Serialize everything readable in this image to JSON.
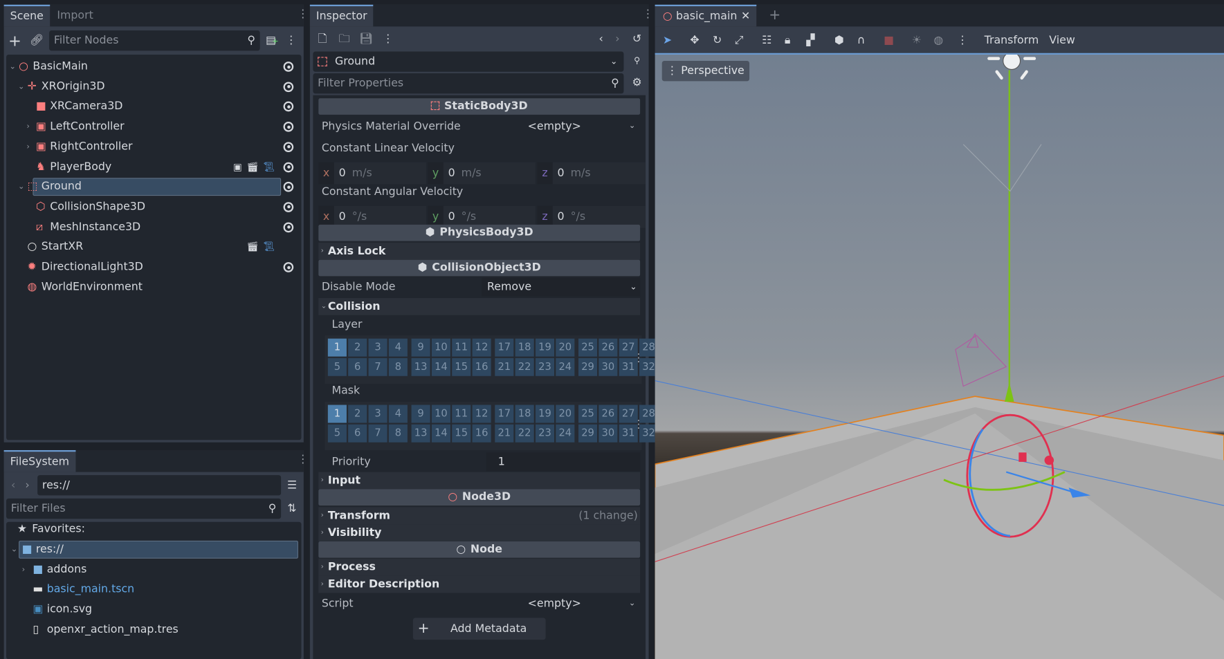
{
  "scene_dock": {
    "tabs": [
      "Scene",
      "Import"
    ],
    "filter_placeholder": "Filter Nodes",
    "nodes": [
      {
        "name": "BasicMain",
        "icon": "node3d-icon",
        "color": "#fc7f7f",
        "depth": 0,
        "expanded": true,
        "visible_toggle": true
      },
      {
        "name": "XROrigin3D",
        "icon": "xr-origin-icon",
        "color": "#fc7f7f",
        "depth": 1,
        "expanded": true,
        "visible_toggle": true
      },
      {
        "name": "XRCamera3D",
        "icon": "xr-camera-icon",
        "color": "#fc7f7f",
        "depth": 2,
        "visible_toggle": true
      },
      {
        "name": "LeftController",
        "icon": "xr-controller-icon",
        "color": "#fc7f7f",
        "depth": 2,
        "collapsed": true,
        "visible_toggle": true
      },
      {
        "name": "RightController",
        "icon": "xr-controller-icon",
        "color": "#fc7f7f",
        "depth": 2,
        "collapsed": true,
        "visible_toggle": true
      },
      {
        "name": "PlayerBody",
        "icon": "xr-body-icon",
        "color": "#fc7f7f",
        "depth": 2,
        "badges": [
          "group-icon",
          "instance-icon",
          "script-icon"
        ],
        "visible_toggle": true
      },
      {
        "name": "Ground",
        "icon": "static-body-icon",
        "color": "#fc7f7f",
        "depth": 1,
        "expanded": true,
        "selected": true,
        "visible_toggle": true
      },
      {
        "name": "CollisionShape3D",
        "icon": "collision-shape-icon",
        "color": "#fc7f7f",
        "depth": 2,
        "visible_toggle": true
      },
      {
        "name": "MeshInstance3D",
        "icon": "mesh-instance-icon",
        "color": "#fc7f7f",
        "depth": 2,
        "visible_toggle": true
      },
      {
        "name": "StartXR",
        "icon": "node-icon",
        "color": "#e0e0e0",
        "depth": 1,
        "badges": [
          "instance-icon",
          "script-icon"
        ]
      },
      {
        "name": "DirectionalLight3D",
        "icon": "light-icon",
        "color": "#fc7f7f",
        "depth": 1,
        "visible_toggle": true
      },
      {
        "name": "WorldEnvironment",
        "icon": "world-environment-icon",
        "color": "#fc7f7f",
        "depth": 1
      }
    ]
  },
  "filesystem": {
    "tab": "FileSystem",
    "path": "res://",
    "filter_placeholder": "Filter Files",
    "favorites_label": "Favorites:",
    "items": [
      {
        "name": "res://",
        "icon": "folder-icon",
        "depth": 0,
        "selected": true
      },
      {
        "name": "addons",
        "icon": "folder-icon",
        "depth": 1
      },
      {
        "name": "basic_main.tscn",
        "icon": "scene-file-icon",
        "depth": 1,
        "highlight": true
      },
      {
        "name": "icon.svg",
        "icon": "image-file-icon",
        "depth": 1
      },
      {
        "name": "openxr_action_map.tres",
        "icon": "resource-file-icon",
        "depth": 1
      }
    ]
  },
  "inspector": {
    "tab": "Inspector",
    "object": "Ground",
    "filter_placeholder": "Filter Properties",
    "static_body": {
      "title": "StaticBody3D",
      "physics_material_label": "Physics Material Override",
      "physics_material_value": "<empty>",
      "linear_label": "Constant Linear Velocity",
      "linear": {
        "x": "0",
        "y": "0",
        "z": "0",
        "unit": "m/s"
      },
      "angular_label": "Constant Angular Velocity",
      "angular": {
        "x": "0",
        "y": "0",
        "z": "0",
        "unit": "°/s"
      }
    },
    "physics_body": {
      "title": "PhysicsBody3D",
      "axis_lock": "Axis Lock"
    },
    "collision_object": {
      "title": "CollisionObject3D",
      "disable_mode_label": "Disable Mode",
      "disable_mode_value": "Remove",
      "collision_section": "Collision",
      "layer_label": "Layer",
      "layer_enabled": [
        1
      ],
      "mask_label": "Mask",
      "mask_enabled": [
        1
      ],
      "priority_label": "Priority",
      "priority_value": "1",
      "input_section": "Input"
    },
    "node3d": {
      "title": "Node3D",
      "transform": "Transform",
      "transform_changes": "(1 change)",
      "visibility": "Visibility"
    },
    "node": {
      "title": "Node",
      "process": "Process",
      "editor_description": "Editor Description"
    },
    "script_label": "Script",
    "script_value": "<empty>",
    "add_metadata": "Add Metadata",
    "axes": {
      "x": "x",
      "y": "y",
      "z": "z"
    }
  },
  "viewport": {
    "scene_tab": "basic_main",
    "menus": [
      "Transform",
      "View"
    ],
    "view_mode": "Perspective"
  },
  "colors": {
    "accent": "#6b9bd1",
    "node3d": "#fc7f7f",
    "selection": "#374c63"
  }
}
